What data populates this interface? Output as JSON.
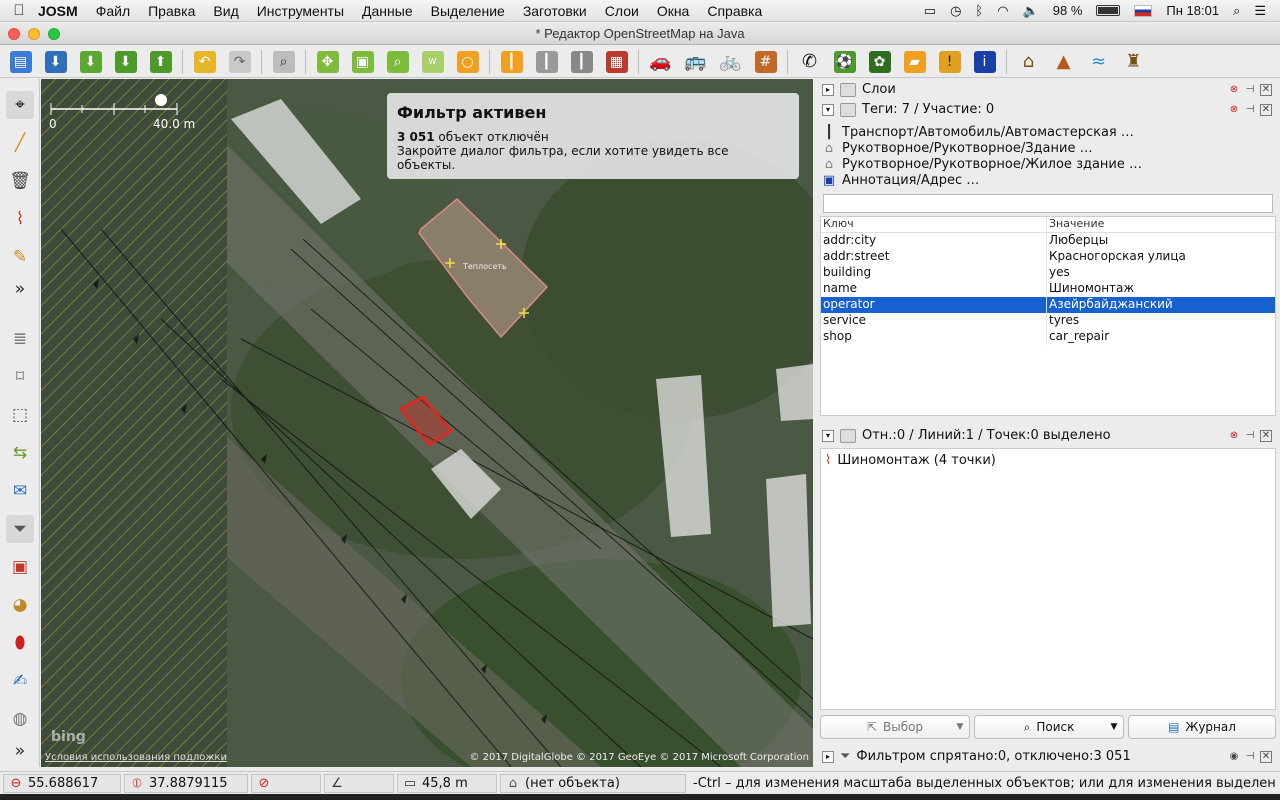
{
  "menubar": {
    "app_name": "JOSM",
    "items": [
      "Файл",
      "Правка",
      "Вид",
      "Инструменты",
      "Данные",
      "Выделение",
      "Заготовки",
      "Слои",
      "Окна",
      "Справка"
    ],
    "battery": "98 %",
    "clock": "Пн 18:01"
  },
  "window": {
    "title": "* Редактор OpenStreetMap на Java"
  },
  "map": {
    "filter_title": "Фильтр активен",
    "filter_count": "3 051",
    "filter_count_text": "объект отключён",
    "filter_hint": "Закройте диалог фильтра, если хотите увидеть все объекты.",
    "scale_start": "0",
    "scale_end": "40.0 m",
    "terms_link": "Условия использования подложки",
    "copyright": "© 2017 DigitalGlobe © 2017 GeoEye © 2017 Microsoft Corporation",
    "bing_logo": "bing",
    "building_label": "Теплосеть"
  },
  "layers_panel": {
    "title": "Слои"
  },
  "tags_panel": {
    "title": "Теги: 7 / Участие: 0",
    "presets": [
      "Транспорт/Автомобиль/Автомастерская …",
      "Рукотворное/Рукотворное/Здание …",
      "Рукотворное/Рукотворное/Жилое здание …",
      "Аннотация/Адрес …"
    ],
    "col_key": "Ключ",
    "col_value": "Значение",
    "rows": [
      {
        "key": "addr:city",
        "value": "Люберцы"
      },
      {
        "key": "addr:street",
        "value": "Красногорская улица"
      },
      {
        "key": "building",
        "value": "yes"
      },
      {
        "key": "name",
        "value": "Шиномонтаж"
      },
      {
        "key": "operator",
        "value": "Азейрбайджанский"
      },
      {
        "key": "service",
        "value": "tyres"
      },
      {
        "key": "shop",
        "value": "car_repair"
      }
    ],
    "selected_row": 4
  },
  "selection_panel": {
    "title": "Отн.:0 / Линий:1 / Точек:0 выделено",
    "items": [
      "Шиномонтаж (4 точки)"
    ],
    "btn_select": "Выбор",
    "btn_search": "Поиск",
    "btn_history": "Журнал"
  },
  "filter_panel": {
    "title": "Фильтром спрятано:0, отключено:3 051"
  },
  "statusbar": {
    "lat": "55.688617",
    "lon": "37.8879115",
    "distance": "45,8 m",
    "object": "(нет объекта)",
    "hint": "-Ctrl – для изменения масштаба выделенных объектов; или для изменения выделения"
  },
  "colors": {
    "selection": "#1660cf",
    "selected_way": "#e8231c",
    "filtered_way": "#d98a84"
  }
}
